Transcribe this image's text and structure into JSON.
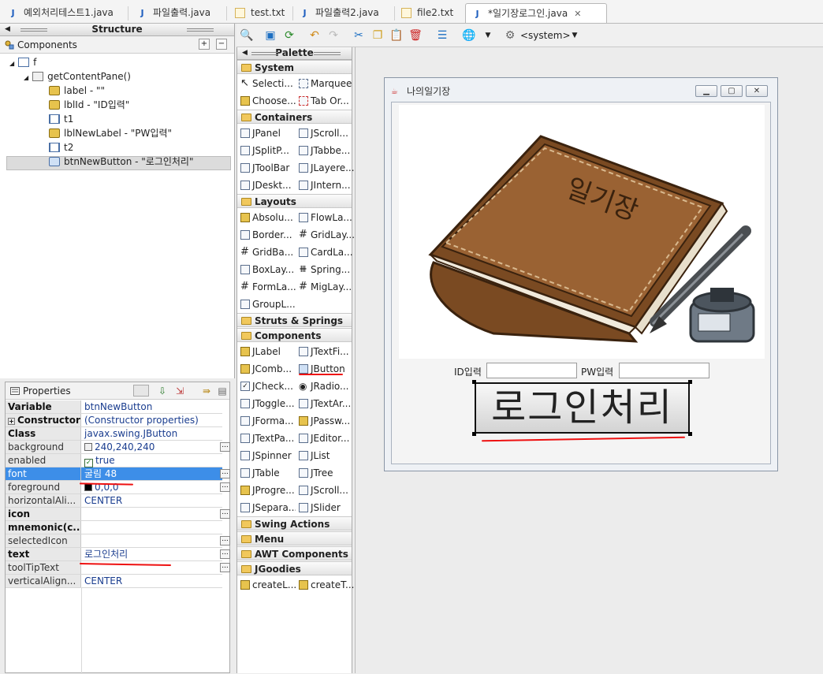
{
  "tabs": [
    {
      "label": "예외처리테스트1.java",
      "kind": "java"
    },
    {
      "label": "파일출력.java",
      "kind": "java"
    },
    {
      "label": "test.txt",
      "kind": "text"
    },
    {
      "label": "파일출력2.java",
      "kind": "java"
    },
    {
      "label": "file2.txt",
      "kind": "text"
    },
    {
      "label": "*일기장로그인.java",
      "kind": "java",
      "active": true
    }
  ],
  "structure": {
    "title": "Structure",
    "components_label": "Components",
    "tree": [
      "f",
      "getContentPane()",
      "label - \"\"",
      "lblId - \"ID입력\"",
      "t1",
      "lblNewLabel - \"PW입력\"",
      "t2",
      "btnNewButton - \"로그인처리\""
    ]
  },
  "properties": {
    "title": "Properties",
    "rows": [
      {
        "name": "Variable",
        "value": "btnNewButton",
        "bold": true
      },
      {
        "name": "Constructor",
        "value": "(Constructor properties)",
        "bold": true
      },
      {
        "name": "Class",
        "value": "javax.swing.JButton",
        "bold": true
      },
      {
        "name": "background",
        "value": "240,240,240",
        "swatch": "#f0f0f0",
        "dots": true
      },
      {
        "name": "enabled",
        "value": "true",
        "check": true
      },
      {
        "name": "font",
        "value": "굴림 48",
        "dots": true,
        "selected": true
      },
      {
        "name": "foreground",
        "value": "0,0,0",
        "swatch": "#000000",
        "dots": true
      },
      {
        "name": "horizontalAli...",
        "value": "CENTER"
      },
      {
        "name": "icon",
        "value": "",
        "bold": true,
        "dots": true
      },
      {
        "name": "mnemonic(c...",
        "value": "",
        "bold": true
      },
      {
        "name": "selectedIcon",
        "value": "",
        "dots": true
      },
      {
        "name": "text",
        "value": "로그인처리",
        "bold": true,
        "dots": true
      },
      {
        "name": "toolTipText",
        "value": "",
        "dots": true
      },
      {
        "name": "verticalAlign...",
        "value": "CENTER"
      }
    ]
  },
  "toolbar": {
    "system_label": "<system>"
  },
  "palette": {
    "title": "Palette",
    "categories": {
      "system": "System",
      "containers": "Containers",
      "layouts": "Layouts",
      "struts": "Struts & Springs",
      "components": "Components",
      "swing_actions": "Swing Actions",
      "menu": "Menu",
      "awt": "AWT Components",
      "jgoodies": "JGoodies"
    },
    "system_items": [
      "Selecti...",
      "Marquee",
      "Choose...",
      "Tab Or..."
    ],
    "container_items": [
      "JPanel",
      "JScroll...",
      "JSplitP...",
      "JTabbe...",
      "JToolBar",
      "JLayere...",
      "JDeskt...",
      "JIntern..."
    ],
    "layout_items": [
      "Absolu...",
      "FlowLa...",
      "Border...",
      "GridLay...",
      "GridBa...",
      "CardLa...",
      "BoxLay...",
      "Spring...",
      "FormLa...",
      "MigLay...",
      "GroupL..."
    ],
    "component_items": [
      "JLabel",
      "JTextFi...",
      "JComb...",
      "JButton",
      "JCheck...",
      "JRadio...",
      "JToggle...",
      "JTextAr...",
      "JForma...",
      "JPassw...",
      "JTextPa...",
      "JEditor...",
      "JSpinner",
      "JList",
      "JTable",
      "JTree",
      "JProgre...",
      "JScroll...",
      "JSepara...",
      "JSlider"
    ],
    "jgoodies_items": [
      "createL...",
      "createT..."
    ]
  },
  "frame": {
    "title": "나의일기장",
    "book_title": "일기장",
    "id_label": "ID입력",
    "pw_label": "PW입력",
    "login_button": "로그인처리"
  },
  "colors": {
    "selection": "#3d8ee8",
    "annotation": "#e11111",
    "book": "#8b5a2b"
  }
}
